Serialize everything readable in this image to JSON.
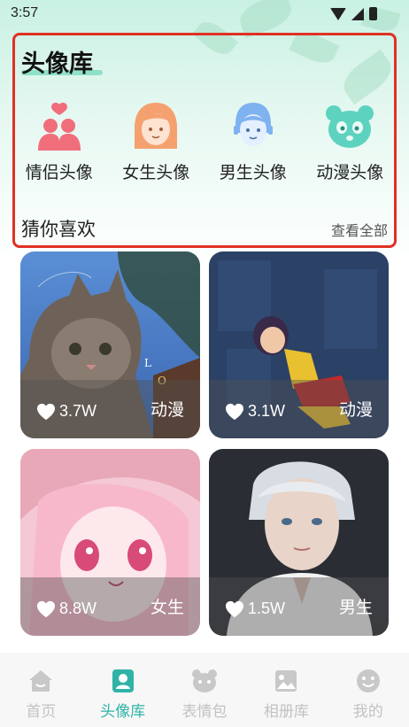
{
  "status_bar": {
    "time": "3:57"
  },
  "header": {
    "title": "头像库"
  },
  "categories": [
    {
      "label": "情侣头像",
      "icon": "couple-icon",
      "color": "#f06e7a"
    },
    {
      "label": "女生头像",
      "icon": "girl-icon",
      "color": "#f5a16f"
    },
    {
      "label": "男生头像",
      "icon": "boy-icon",
      "color": "#7fb2f0"
    },
    {
      "label": "动漫头像",
      "icon": "panda-icon",
      "color": "#5dd3bf"
    }
  ],
  "section": {
    "title": "猜你喜欢",
    "see_all": "查看全部"
  },
  "cards": [
    {
      "likes": "3.7W",
      "tag": "动漫"
    },
    {
      "likes": "3.1W",
      "tag": "动漫"
    },
    {
      "likes": "8.8W",
      "tag": "女生"
    },
    {
      "likes": "1.5W",
      "tag": "男生"
    }
  ],
  "tabs": [
    {
      "label": "首页",
      "icon": "home-icon",
      "active": false
    },
    {
      "label": "头像库",
      "icon": "avatar-icon",
      "active": true
    },
    {
      "label": "表情包",
      "icon": "bear-icon",
      "active": false
    },
    {
      "label": "相册库",
      "icon": "album-icon",
      "active": false
    },
    {
      "label": "我的",
      "icon": "smile-icon",
      "active": false
    }
  ],
  "colors": {
    "accent": "#2fb3a6",
    "highlight_border": "#e03124",
    "inactive_tab": "#c2c2c2"
  }
}
